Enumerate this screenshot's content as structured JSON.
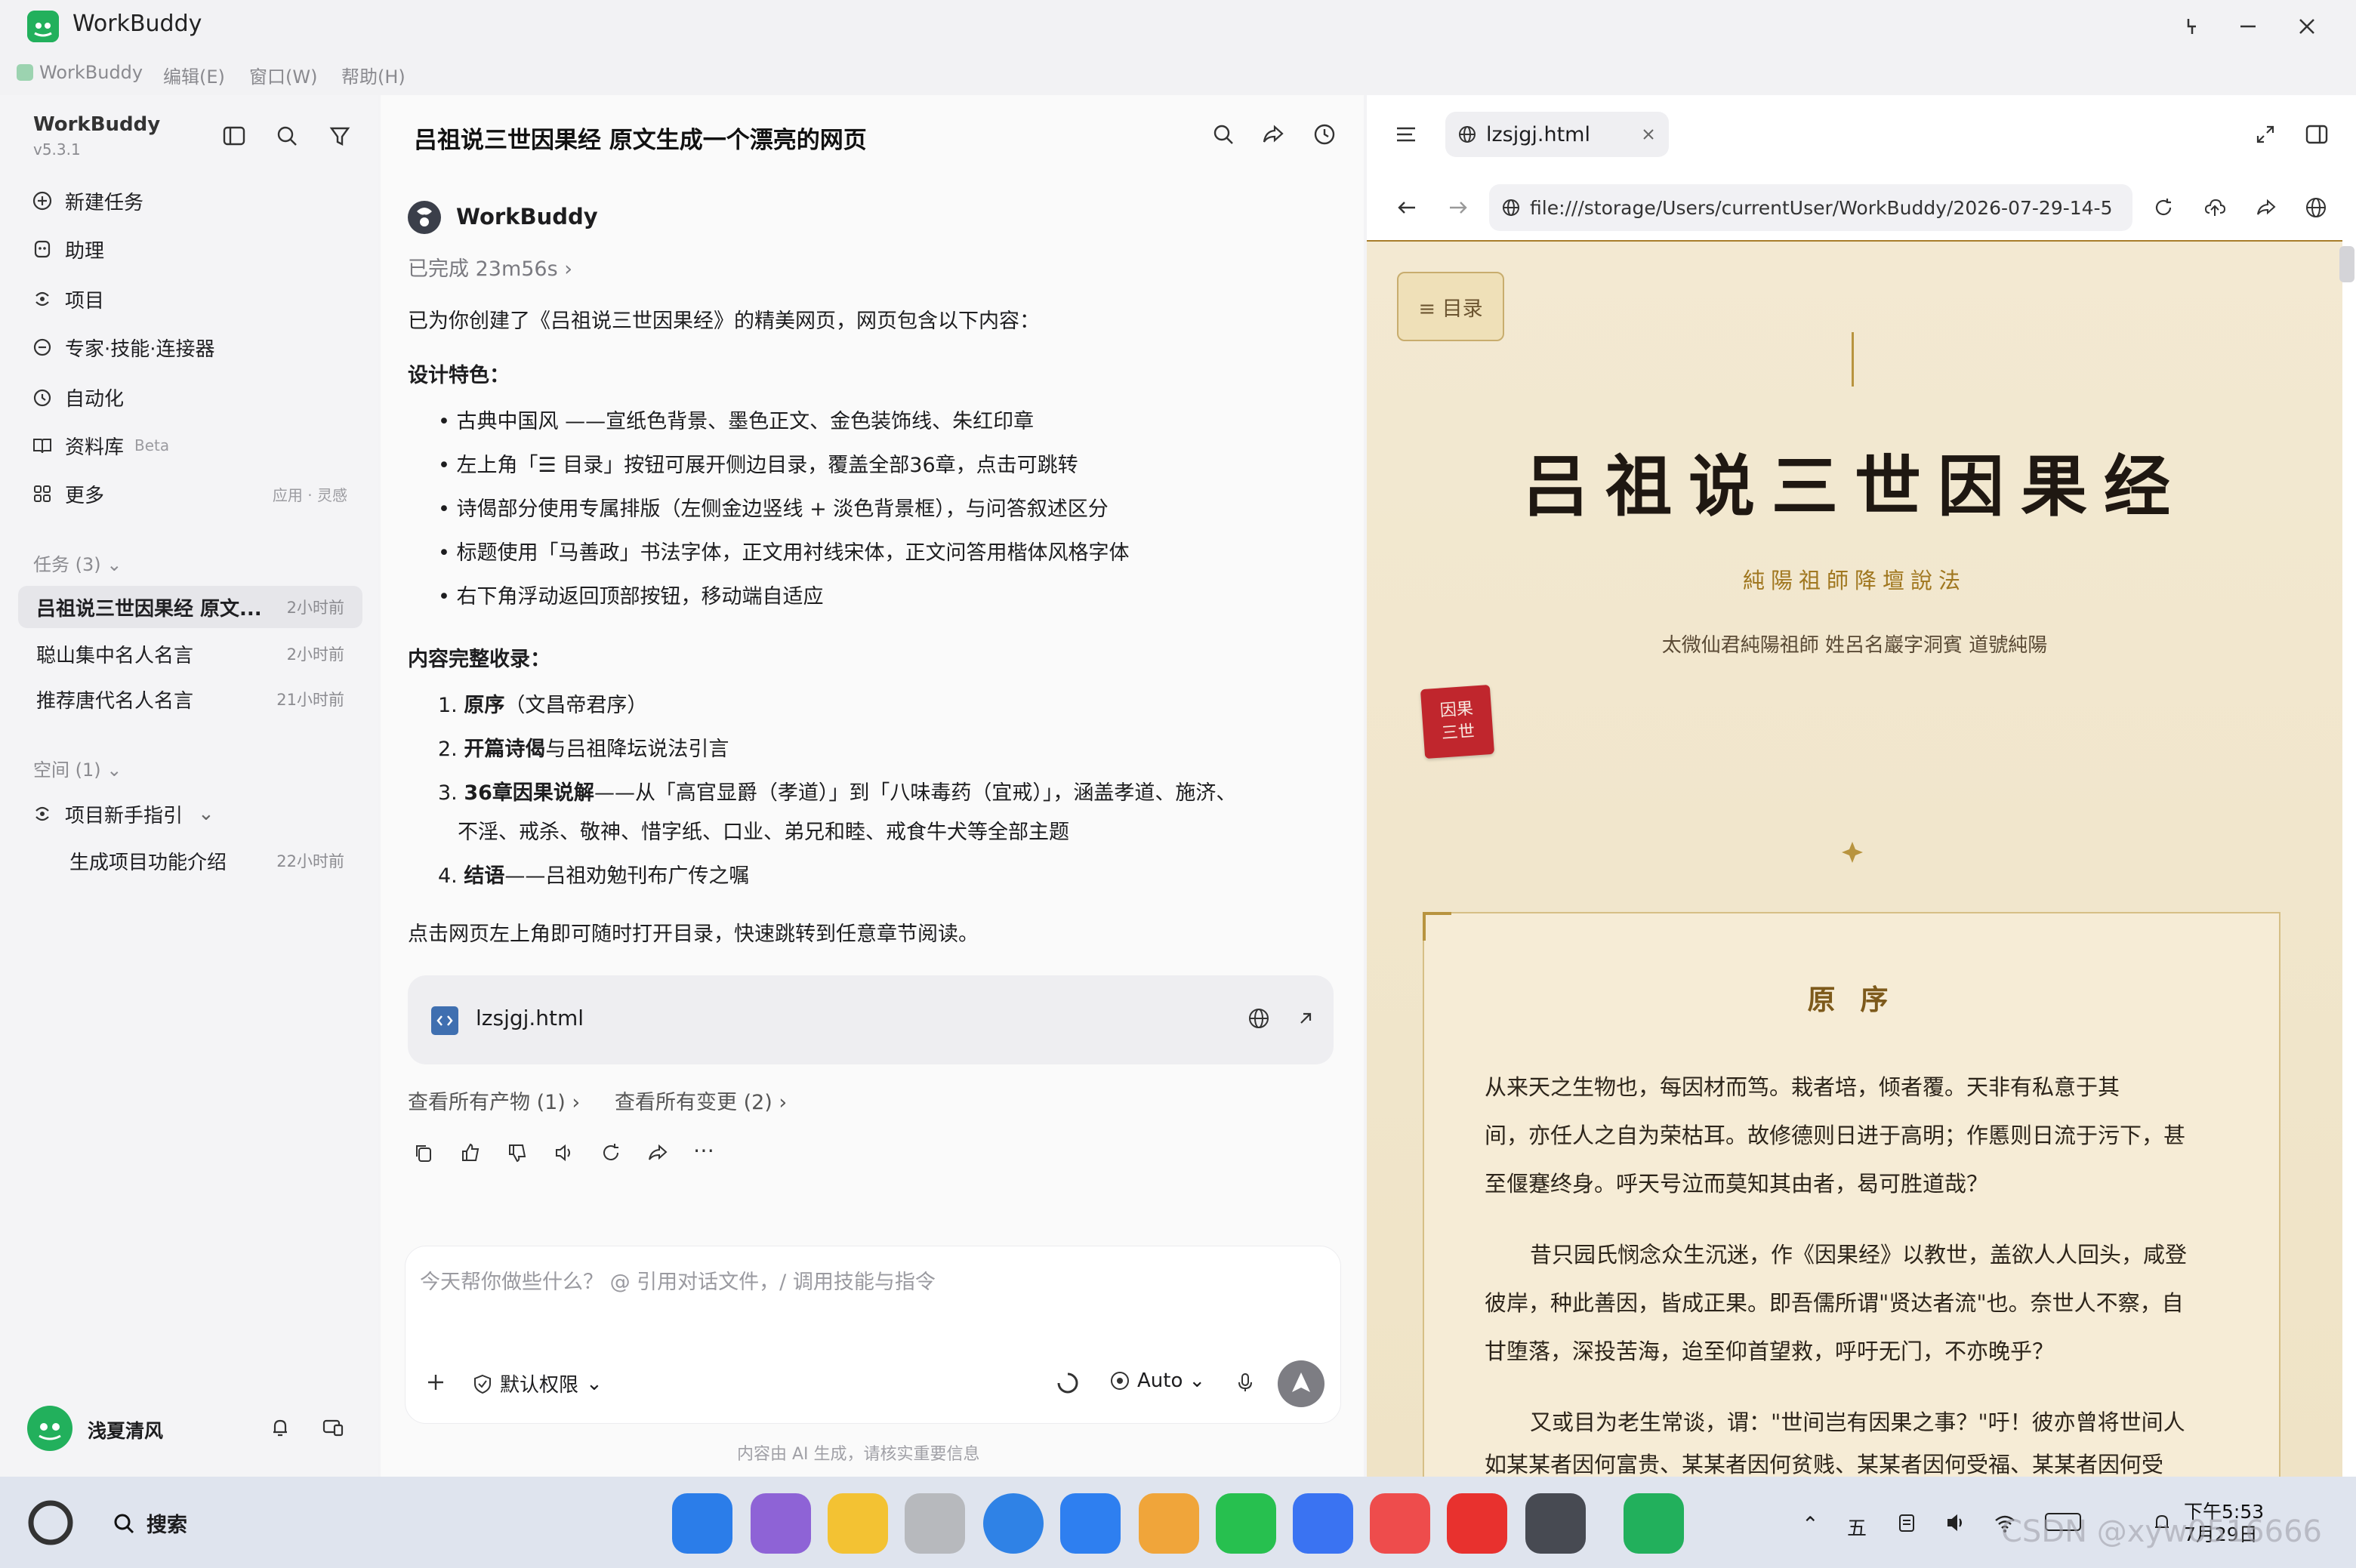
{
  "app": {
    "name": "WorkBuddy",
    "version": "v5.3.1",
    "menu": [
      "WorkBuddy",
      "编辑(E)",
      "窗口(W)",
      "帮助(H)"
    ]
  },
  "sidebar": {
    "nav": [
      {
        "label": "新建任务",
        "icon": "plus-circle-icon"
      },
      {
        "label": "助理",
        "icon": "assistant-icon"
      },
      {
        "label": "项目",
        "icon": "project-icon"
      },
      {
        "label": "专家·技能·连接器",
        "icon": "expert-icon"
      },
      {
        "label": "自动化",
        "icon": "clock-icon"
      },
      {
        "label": "资料库",
        "icon": "book-icon",
        "badge": "Beta"
      },
      {
        "label": "更多",
        "icon": "grid-icon",
        "sub": "应用 · 灵感"
      }
    ],
    "tasks_header": "任务 (3)",
    "tasks": [
      {
        "title": "吕祖说三世因果经 原文...",
        "time": "2小时前"
      },
      {
        "title": "聪山集中名人名言",
        "time": "2小时前"
      },
      {
        "title": "推荐唐代名人名言",
        "time": "21小时前"
      }
    ],
    "spaces_header": "空间 (1)",
    "space": {
      "name": "项目新手指引",
      "child": "生成项目功能介绍",
      "child_time": "22小时前"
    },
    "user": {
      "name": "浅夏清风"
    }
  },
  "chat": {
    "title": "吕祖说三世因果经 原文生成一个漂亮的网页",
    "sender": "WorkBuddy",
    "status": "已完成 23m56s",
    "intro": "已为你创建了《吕祖说三世因果经》的精美网页，网页包含以下内容：",
    "design_heading": "设计特色：",
    "design_items": [
      "古典中国风 ——宣纸色背景、墨色正文、金色装饰线、朱红印章",
      "左上角「☰ 目录」按钮可展开侧边目录，覆盖全部36章，点击可跳转",
      "诗偈部分使用专属排版（左侧金边竖线 + 淡色背景框），与问答叙述区分",
      "标题使用「马善政」书法字体，正文用衬线宋体，正文问答用楷体风格字体",
      "右下角浮动返回顶部按钮，移动端自适应"
    ],
    "content_heading": "内容完整收录：",
    "content_items": [
      {
        "num": "1.",
        "bold": "原序",
        "rest": "（文昌帝君序）"
      },
      {
        "num": "2.",
        "bold": "开篇诗偈",
        "rest": "与吕祖降坛说法引言"
      },
      {
        "num": "3.",
        "bold": "36章因果说解",
        "rest": "——从「高官显爵（孝道）」到「八味毒药（宜戒）」，涵盖孝道、施济、",
        "rest2": "不淫、戒杀、敬神、惜字纸、口业、弟兄和睦、戒食牛犬等全部主题"
      },
      {
        "num": "4.",
        "bold": "结语",
        "rest": "——吕祖劝勉刊布广传之嘱"
      }
    ],
    "closing": "点击网页左上角即可随时打开目录，快速跳转到任意章节阅读。",
    "file_name": "lzsjgj.html",
    "artifacts_link": "查看所有产物 (1)",
    "changes_link": "查看所有变更 (2)",
    "composer_placeholder": "今天帮你做些什么？ @ 引用对话文件，/ 调用技能与指令",
    "permission": "默认权限",
    "model": "Auto",
    "disclaimer": "内容由 AI 生成，请核实重要信息"
  },
  "viewer": {
    "tab": "lzsjgj.html",
    "url": "file:///storage/Users/currentUser/WorkBuddy/2026-07-29-14-5",
    "toc_button": "≡ 目录",
    "doc_title": "吕祖说三世因果经",
    "doc_subtitle": "純陽祖師降壇說法",
    "doc_author": "太微仙君純陽祖師 姓呂名巖字洞賓 道號純陽",
    "seal_text": "因果三世",
    "section_title": "原 序",
    "paras": [
      [
        "从来天之生物也，每因材而笃。栽者培，倾者覆。天非有私意于其",
        "间，亦任人之自为荣枯耳。故修德则日进于高明；作慝则日流于污下，甚",
        "至偃蹇终身。呼天号泣而莫知其由者，曷可胜道哉？"
      ],
      [
        "昔只园氏悯念众生沉迷，作《因果经》以教世，盖欲人人回头，咸登",
        "彼岸，种此善因，皆成正果。即吾儒所谓\"贤达者流\"也。奈世人不察，自",
        "甘堕落，深投苦海，迨至仰首望救，呼吁无门，不亦晚乎？"
      ],
      [
        "又或目为老生常谈，谓：\"世间岂有因果之事？\"吁！彼亦曾将世间人",
        "如某某者因何富贵、某某者因何贫贱、某某者因何受福、某某者因何受"
      ]
    ]
  },
  "taskbar": {
    "search": "搜索",
    "ime": "五",
    "time": "下午5:53",
    "date": "7月29日",
    "watermark": "CSDN @xyw0516666"
  },
  "colors": {
    "accent": "#22b05c",
    "gold": "#a87d2b",
    "seal": "#c0262d",
    "paper": "#f1e6cc"
  }
}
